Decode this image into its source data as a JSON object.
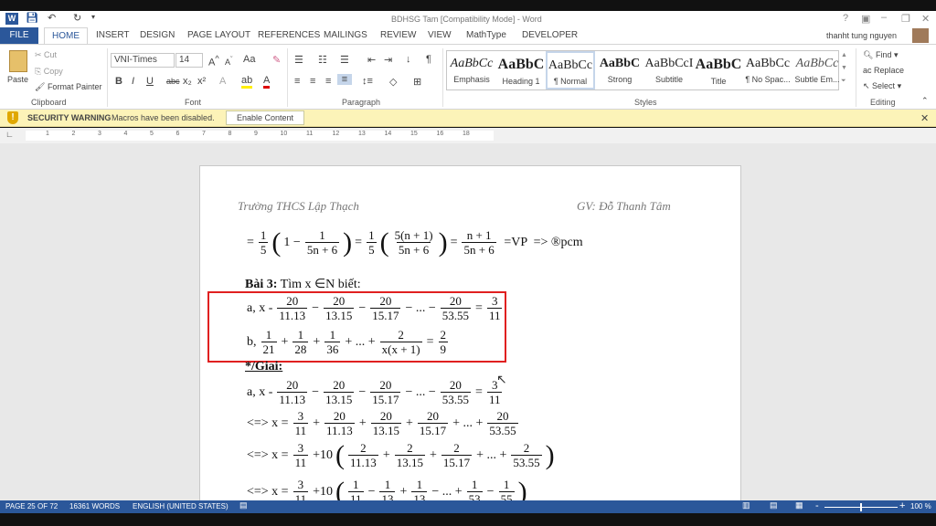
{
  "window": {
    "title": "BDHSG Tam [Compatibility Mode] - Word",
    "user": "thanht tung nguyen",
    "controls": [
      "?",
      "restore-ribbon",
      "minimize",
      "maximize",
      "close"
    ]
  },
  "tabs": [
    "FILE",
    "HOME",
    "INSERT",
    "DESIGN",
    "PAGE LAYOUT",
    "REFERENCES",
    "MAILINGS",
    "REVIEW",
    "VIEW",
    "MathType",
    "DEVELOPER"
  ],
  "clipboard": {
    "paste": "Paste",
    "cut": "Cut",
    "copy": "Copy",
    "format_painter": "Format Painter",
    "label": "Clipboard"
  },
  "font": {
    "name": "VNI-Times",
    "size": "14",
    "label": "Font",
    "bold": "B",
    "italic": "I",
    "underline": "U",
    "strike": "abc",
    "sub": "x₂",
    "sup": "x²",
    "case": "Aa"
  },
  "paragraph": {
    "label": "Paragraph"
  },
  "styles": {
    "label": "Styles",
    "items": [
      {
        "preview": "AaBbCc",
        "name": "Emphasis",
        "css": "font-style:italic"
      },
      {
        "preview": "AaBbC",
        "name": "Heading 1",
        "css": "font-weight:bold;font-size:16px"
      },
      {
        "preview": "AaBbCc",
        "name": "¶ Normal",
        "css": ""
      },
      {
        "preview": "AaBbC",
        "name": "Strong",
        "css": "font-weight:bold"
      },
      {
        "preview": "AaBbCcI",
        "name": "Subtitle",
        "css": ""
      },
      {
        "preview": "AaBbC",
        "name": "Title",
        "css": "font-weight:bold;font-size:16px"
      },
      {
        "preview": "AaBbCc",
        "name": "¶ No Spac...",
        "css": ""
      },
      {
        "preview": "AaBbCc",
        "name": "Subtle Em...",
        "css": "font-style:italic;color:#555"
      }
    ]
  },
  "editing": {
    "find": "Find",
    "replace": "Replace",
    "select": "Select",
    "label": "Editing"
  },
  "security": {
    "title": "SECURITY WARNING",
    "message": "Macros have been disabled.",
    "button": "Enable Content"
  },
  "ruler": [
    "1",
    "2",
    "3",
    "4",
    "5",
    "6",
    "7",
    "8",
    "9",
    "10",
    "11",
    "12",
    "13",
    "14",
    "15",
    "16",
    "18"
  ],
  "document": {
    "header_left": "Trường THCS Lập Thạch",
    "header_right": "GV: Đỗ Thanh Tâm",
    "bai3": {
      "bold": "Bài 3:",
      "rest": " Tìm x ∈N biết:"
    },
    "giai": "*/Giai:",
    "equations": [
      [
        {
          "t": "="
        },
        {
          "n": "1",
          "d": "5"
        },
        {
          "p": "("
        },
        {
          "t": "1 −"
        },
        {
          "n": "1",
          "d": "5n + 6"
        },
        {
          "p": ")"
        },
        {
          "t": "="
        },
        {
          "n": "1",
          "d": "5"
        },
        {
          "p": "("
        },
        {
          "n": "5(n + 1)",
          "d": "5n + 6"
        },
        {
          "p": ")"
        },
        {
          "t": "="
        },
        {
          "n": "n + 1",
          "d": "5n + 6"
        },
        {
          "t": " =VP  => ®pcm"
        }
      ],
      [
        {
          "t": "a, x -"
        },
        {
          "n": "20",
          "d": "11.13"
        },
        {
          "t": "−"
        },
        {
          "n": "20",
          "d": "13.15"
        },
        {
          "t": "−"
        },
        {
          "n": "20",
          "d": "15.17"
        },
        {
          "t": "− ... −"
        },
        {
          "n": "20",
          "d": "53.55"
        },
        {
          "t": "="
        },
        {
          "n": "3",
          "d": "11"
        }
      ],
      [
        {
          "t": "b,"
        },
        {
          "n": "1",
          "d": "21"
        },
        {
          "t": "+"
        },
        {
          "n": "1",
          "d": "28"
        },
        {
          "t": "+"
        },
        {
          "n": "1",
          "d": "36"
        },
        {
          "t": "+ ... +"
        },
        {
          "n": "2",
          "d": "x(x + 1)"
        },
        {
          "t": "="
        },
        {
          "n": "2",
          "d": "9"
        }
      ],
      [
        {
          "t": "a, x -"
        },
        {
          "n": "20",
          "d": "11.13"
        },
        {
          "t": "−"
        },
        {
          "n": "20",
          "d": "13.15"
        },
        {
          "t": "−"
        },
        {
          "n": "20",
          "d": "15.17"
        },
        {
          "t": "− ... −"
        },
        {
          "n": "20",
          "d": "53.55"
        },
        {
          "t": "="
        },
        {
          "n": "3",
          "d": "11"
        }
      ],
      [
        {
          "t": "<=> x ="
        },
        {
          "n": "3",
          "d": "11"
        },
        {
          "t": "+"
        },
        {
          "n": "20",
          "d": "11.13"
        },
        {
          "t": "+"
        },
        {
          "n": "20",
          "d": "13.15"
        },
        {
          "t": "+"
        },
        {
          "n": "20",
          "d": "15.17"
        },
        {
          "t": "+ ... +"
        },
        {
          "n": "20",
          "d": "53.55"
        }
      ],
      [
        {
          "t": "<=> x ="
        },
        {
          "n": "3",
          "d": "11"
        },
        {
          "t": "+10"
        },
        {
          "p": "("
        },
        {
          "n": "2",
          "d": "11.13"
        },
        {
          "t": "+"
        },
        {
          "n": "2",
          "d": "13.15"
        },
        {
          "t": "+"
        },
        {
          "n": "2",
          "d": "15.17"
        },
        {
          "t": "+ ... +"
        },
        {
          "n": "2",
          "d": "53.55"
        },
        {
          "p": ")"
        }
      ],
      [
        {
          "t": "<=> x ="
        },
        {
          "n": "3",
          "d": "11"
        },
        {
          "t": "+10"
        },
        {
          "p": "("
        },
        {
          "n": "1",
          "d": "11"
        },
        {
          "t": "−"
        },
        {
          "n": "1",
          "d": "13"
        },
        {
          "t": "+"
        },
        {
          "n": "1",
          "d": "13"
        },
        {
          "t": "− ... +"
        },
        {
          "n": "1",
          "d": "53"
        },
        {
          "t": "−"
        },
        {
          "n": "1",
          "d": "55"
        },
        {
          "p": ")"
        }
      ]
    ]
  },
  "status": {
    "page": "PAGE 25 OF 72",
    "words": "16361 WORDS",
    "language": "ENGLISH (UNITED STATES)",
    "zoom": "100 %",
    "zoom_percent": 100
  },
  "colors": {
    "accent": "#2b579a",
    "warning_bg": "#fcf3b8",
    "highlight_box": "#e02020"
  }
}
